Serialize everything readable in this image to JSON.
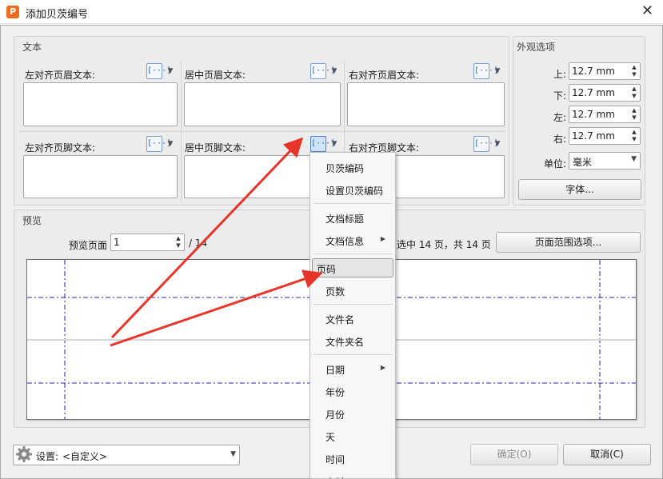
{
  "window": {
    "title": "添加贝茨编号",
    "app_icon_letter": "P",
    "close_glyph": "✕"
  },
  "text_group": {
    "title": "文本",
    "macro_glyph": "[···]",
    "header_left_label": "左对齐页眉文本:",
    "header_center_label": "居中页眉文本:",
    "header_right_label": "右对齐页眉文本:",
    "footer_left_label": "左对齐页脚文本:",
    "footer_center_label": "居中页脚文本:",
    "footer_right_label": "右对齐页脚文本:"
  },
  "appearance_group": {
    "title": "外观选项",
    "top_label": "上:",
    "top_value": "12.7 mm",
    "bottom_label": "下:",
    "bottom_value": "12.7 mm",
    "left_label": "左:",
    "left_value": "12.7 mm",
    "right_label": "右:",
    "right_value": "12.7 mm",
    "unit_label": "单位:",
    "unit_value": "毫米",
    "font_button": "字体..."
  },
  "preview_group": {
    "title": "预览",
    "page_label": "预览页面",
    "page_value": "1",
    "page_total": "/ 14",
    "range_text": "选中 14 页，共 14 页",
    "range_button": "页面范围选项..."
  },
  "footer": {
    "settings_label": "设置:",
    "settings_value": "<自定义>",
    "ok_button": "确定(O)",
    "cancel_button": "取消(C)"
  },
  "menu": {
    "items": [
      {
        "label": "贝茨编码"
      },
      {
        "label": "设置贝茨编码"
      },
      {
        "label": "文档标题"
      },
      {
        "label": "文档信息"
      },
      {
        "label": "页码"
      },
      {
        "label": "页数"
      },
      {
        "label": "文件名"
      },
      {
        "label": "文件夹名"
      },
      {
        "label": "日期"
      },
      {
        "label": "年份"
      },
      {
        "label": "月份"
      },
      {
        "label": "天"
      },
      {
        "label": "时间"
      },
      {
        "label": "小时"
      }
    ],
    "highlighted": "页码"
  },
  "colors": {
    "annotation_arrow": "#e8352a",
    "preview_guides": "#2020b0",
    "accent": "#2e66c4"
  }
}
